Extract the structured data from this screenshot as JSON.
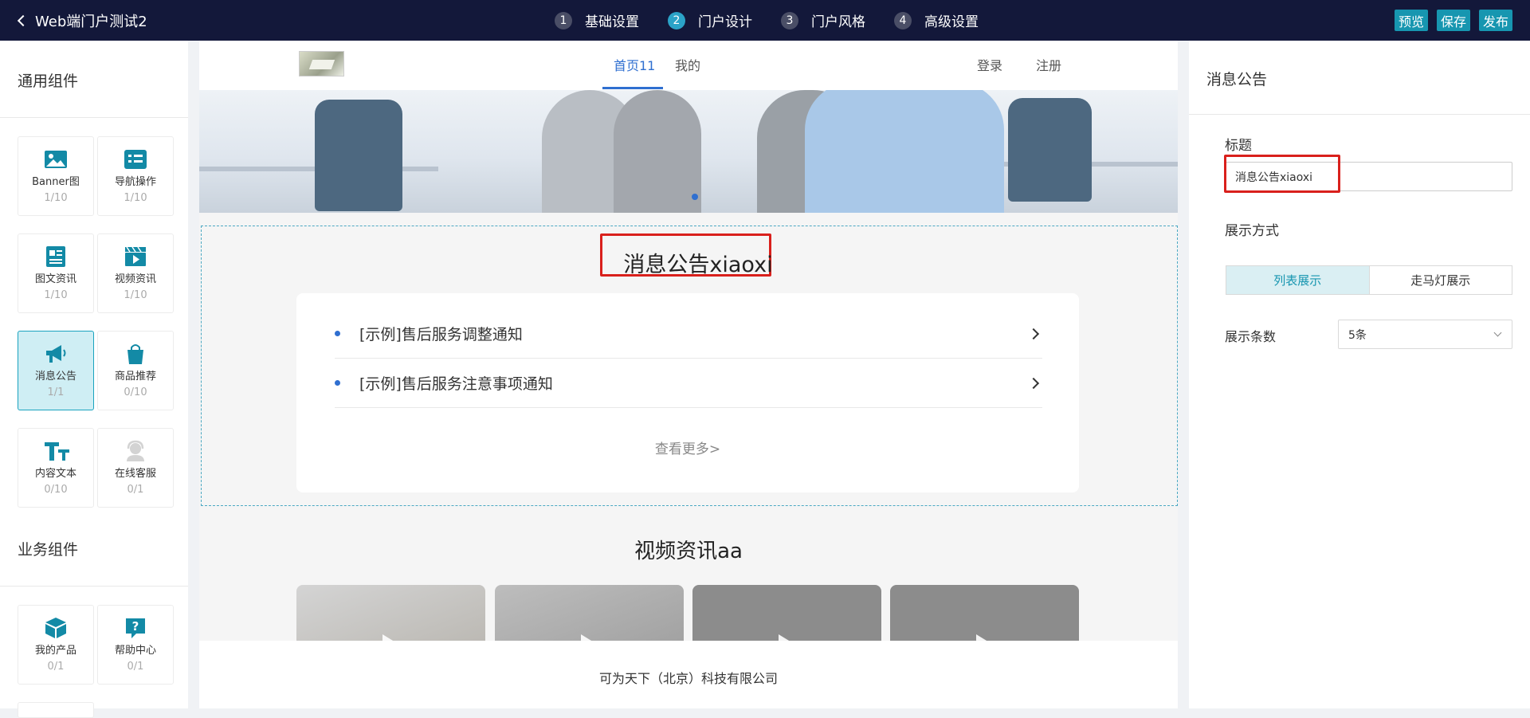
{
  "header": {
    "back_label": "Web端门户测试2",
    "steps": [
      {
        "num": "1",
        "label": "基础设置"
      },
      {
        "num": "2",
        "label": "门户设计"
      },
      {
        "num": "3",
        "label": "门户风格"
      },
      {
        "num": "4",
        "label": "高级设置"
      }
    ],
    "actions": {
      "preview": "预览",
      "save": "保存",
      "publish": "发布"
    },
    "active_step": "2"
  },
  "left_panel": {
    "general_title": "通用组件",
    "business_title": "业务组件",
    "general_components": [
      {
        "name": "Banner图",
        "count": "1/10",
        "icon": "image-icon"
      },
      {
        "name": "导航操作",
        "count": "1/10",
        "icon": "nav-grid-icon"
      },
      {
        "name": "图文资讯",
        "count": "1/10",
        "icon": "article-icon"
      },
      {
        "name": "视频资讯",
        "count": "1/10",
        "icon": "video-icon"
      },
      {
        "name": "消息公告",
        "count": "1/1",
        "icon": "megaphone-icon",
        "selected": true
      },
      {
        "name": "商品推荐",
        "count": "0/10",
        "icon": "shopping-bag-icon"
      },
      {
        "name": "内容文本",
        "count": "0/10",
        "icon": "text-icon"
      },
      {
        "name": "在线客服",
        "count": "0/1",
        "icon": "customer-service-icon"
      }
    ],
    "business_components": [
      {
        "name": "我的产品",
        "count": "0/1",
        "icon": "box-icon"
      },
      {
        "name": "帮助中心",
        "count": "0/1",
        "icon": "help-icon"
      }
    ]
  },
  "canvas": {
    "nav": {
      "links": [
        "首页11",
        "我的"
      ],
      "login": "登录",
      "register": "注册"
    },
    "notice": {
      "title": "消息公告xiaoxi",
      "items": [
        "[示例]售后服务调整通知",
        "[示例]售后服务注意事项通知"
      ],
      "more": "查看更多>"
    },
    "video_section_title": "视频资讯aa",
    "footer": "可为天下（北京）科技有限公司"
  },
  "right_panel": {
    "title": "消息公告",
    "title_label": "标题",
    "title_value": "消息公告xiaoxi",
    "display_label": "展示方式",
    "display_options": [
      "列表展示",
      "走马灯展示"
    ],
    "display_selected": "列表展示",
    "count_label": "展示条数",
    "count_value": "5条"
  },
  "colors": {
    "topbar": "#13183a",
    "accent": "#1796b0",
    "highlight": "#d9201c",
    "link": "#2f6fd0"
  }
}
